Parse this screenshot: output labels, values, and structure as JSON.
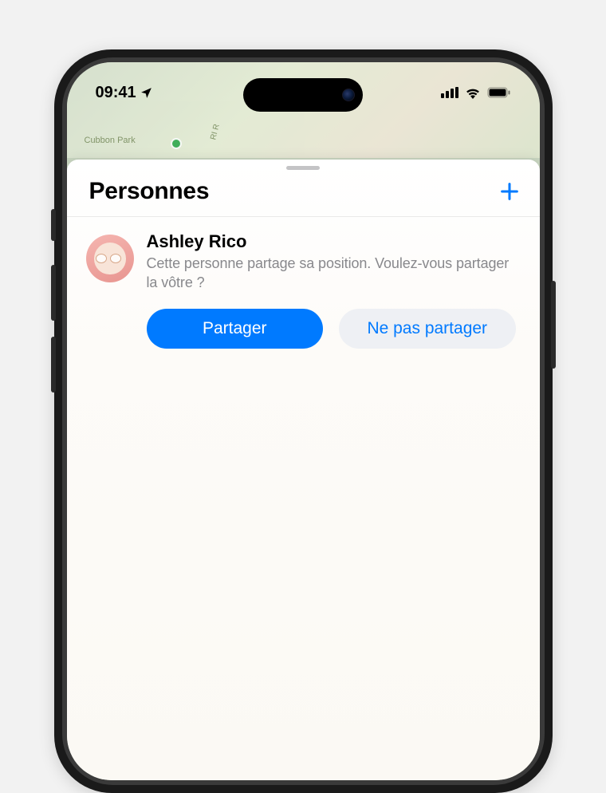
{
  "status_bar": {
    "time": "09:41",
    "location_icon": "location-arrow"
  },
  "map": {
    "park_label": "Cubbon Park",
    "road_hint": "RI R"
  },
  "sheet": {
    "title": "Personnes",
    "add_icon": "plus",
    "person": {
      "name": "Ashley Rico",
      "subtitle": "Cette personne partage sa position. Voulez-vous partager la vôtre ?"
    },
    "actions": {
      "share": "Partager",
      "dont_share": "Ne pas parta­ger"
    }
  },
  "colors": {
    "accent": "#007aff",
    "secondary_bg": "#eef0f4",
    "text_gray": "#88888c"
  }
}
